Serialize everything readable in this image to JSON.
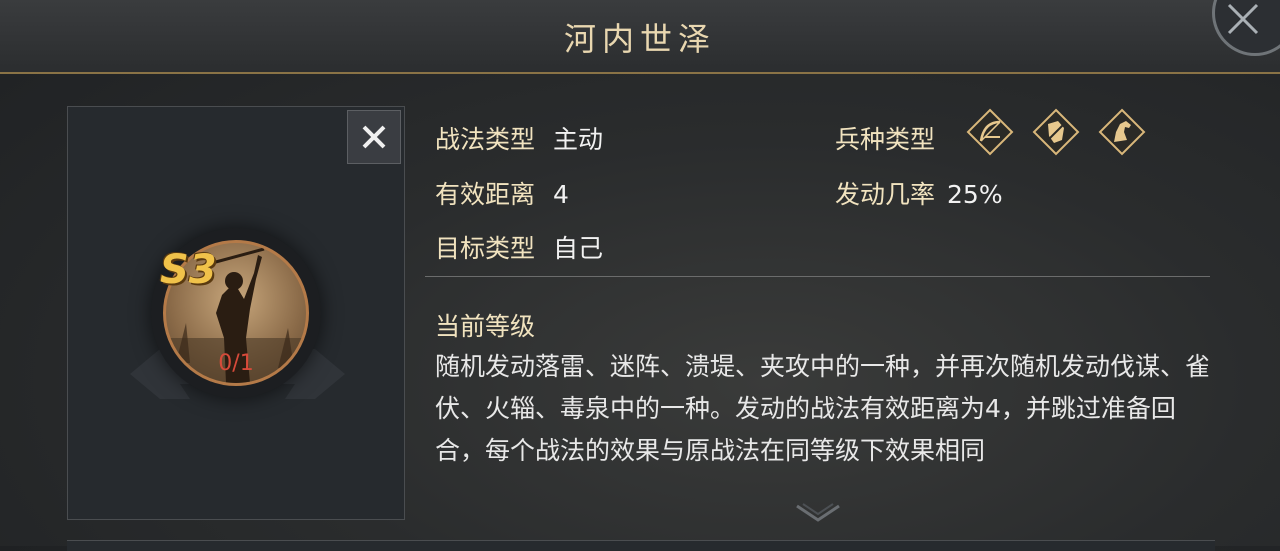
{
  "header": {
    "title": "河内世泽"
  },
  "skill": {
    "level": "S3",
    "count": "0/1"
  },
  "attributes": {
    "tactic_type_label": "战法类型",
    "tactic_type_value": "主动",
    "range_label": "有效距离",
    "range_value": "4",
    "target_label": "目标类型",
    "target_value": "自己",
    "troop_type_label": "兵种类型",
    "troop_icons": [
      "bow-icon",
      "shield-icon",
      "horse-icon"
    ],
    "trigger_label": "发动几率",
    "trigger_value": "25%"
  },
  "description": {
    "section_title": "当前等级",
    "text": "随机发动落雷、迷阵、溃堤、夹攻中的一种，并再次随机发动伐谋、雀伏、火辎、毒泉中的一种。发动的战法有效距离为4，并跳过准备回合，每个战法的效果与原战法在同等级下效果相同"
  },
  "colors": {
    "accent_gold": "#e9d7b0",
    "level_gold": "#f0c24a",
    "count_red": "#d64a3a"
  }
}
